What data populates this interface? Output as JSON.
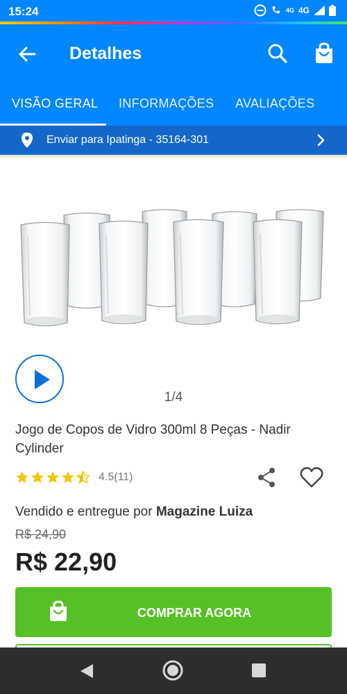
{
  "status_bar": {
    "time": "15:24",
    "network": "4G",
    "network_small": "4G"
  },
  "app_bar": {
    "title": "Detalhes"
  },
  "tabs": [
    {
      "label": "VISÃO GERAL",
      "active": true
    },
    {
      "label": "INFORMAÇÕES",
      "active": false
    },
    {
      "label": "AVALIAÇÕES",
      "active": false
    }
  ],
  "shipping": {
    "label": "Enviar para Ipatinga - 35164-301"
  },
  "gallery": {
    "pager": "1/4"
  },
  "product": {
    "title": "Jogo de Copos de Vidro 300ml 8 Peças - Nadir Cylinder",
    "rating": 4.5,
    "rating_text": "4.5(11)",
    "seller_prefix": "Vendido e entregue por",
    "seller_name": "Magazine Luiza",
    "old_price": "R$ 24,90",
    "price": "R$ 22,90"
  },
  "buy_button": {
    "label": "COMPRAR AGORA"
  },
  "colors": {
    "primary_blue": "#0086ff",
    "shipping_blue": "#1466c9",
    "buy_green": "#56c126",
    "star_yellow": "#f5c400"
  }
}
